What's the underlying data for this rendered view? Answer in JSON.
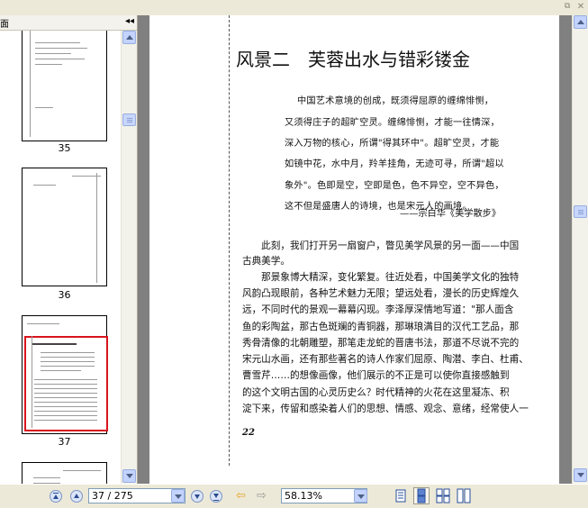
{
  "panel": {
    "title_fragment": "面",
    "collapse_glyph": "◂◂"
  },
  "thumbnails": [
    {
      "number": "35"
    },
    {
      "number": "36"
    },
    {
      "number": "37",
      "selected": true
    }
  ],
  "document": {
    "chapter_title_a": "风景二",
    "chapter_title_b": "芙蓉出水与错彩镂金",
    "quote_lines": [
      "中国艺术意境的创成，既须得屈原的缠绵悱恻，",
      "又须得庄子的超旷空灵。缠绵悱恻，才能一往情深，",
      "深入万物的核心，所谓\"得其环中\"。超旷空灵，才能",
      "如镜中花，水中月，羚羊挂角，无迹可寻，所谓\"超以",
      "象外\"。色即是空，空即是色，色不异空，空不异色，",
      "这不但是盛唐人的诗境，也是宋元人的画境。"
    ],
    "quote_source": "——宗白华《美学散步》",
    "body_lines": [
      "　　此刻，我们打开另一扇窗户，瞥见美学风景的另一面——中国",
      "古典美学。",
      "　　那景象博大精深，变化繁复。往近处看，中国美学文化的独特",
      "风韵凸现眼前，各种艺术魅力无限；望远处看，漫长的历史辉煌久",
      "远，不同时代的景观一幕幕闪现。李泽厚深情地写道：\"那人面含",
      "鱼的彩陶盆，那古色斑斓的青铜器，那琳琅满目的汉代工艺品，那",
      "秀骨清像的北朝雕塑，那笔走龙蛇的晋唐书法，那道不尽说不完的",
      "宋元山水画，还有那些著名的诗人作家们屈原、陶潜、李白、杜甫、",
      "曹雪芹……的想像画像，他们展示的不正是可以使你直接感触到",
      "的这个文明古国的心灵历史么？时代精神的火花在这里凝冻、积",
      "淀下来，传留和感染着人们的思想、情感、观念、意绪，经常使人一"
    ],
    "page_number": "22"
  },
  "statusbar": {
    "page_field": "37 / 275",
    "zoom_field": "58.13%"
  },
  "colors": {
    "selection_ring": "#d9141c",
    "back_arrow": "#e7a32a",
    "forward_arrow": "#9a9a9a"
  }
}
